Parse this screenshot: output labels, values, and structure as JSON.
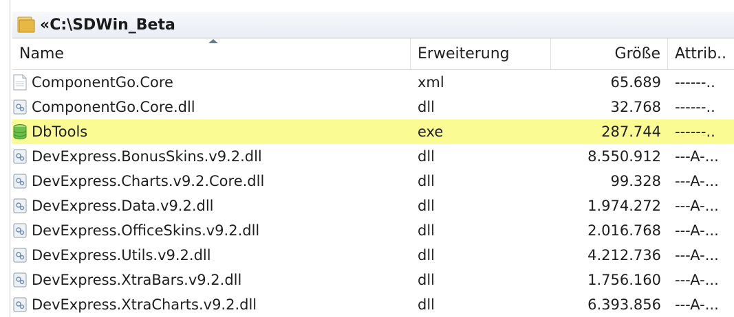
{
  "path": {
    "label": "«C:\\SDWin_Beta"
  },
  "columns": {
    "name": "Name",
    "ext": "Erweiterung",
    "size": "Größe",
    "attr": "Attrib.."
  },
  "rows": [
    {
      "name": "ComponentGo.Core",
      "ext": "xml",
      "size": "65.689",
      "attr": "------..",
      "icon": "xml-document-icon"
    },
    {
      "name": "ComponentGo.Core.dll",
      "ext": "dll",
      "size": "32.768",
      "attr": "------..",
      "icon": "dll-icon"
    },
    {
      "name": "DbTools",
      "ext": "exe",
      "size": "287.744",
      "attr": "------..",
      "icon": "database-icon",
      "highlight": true
    },
    {
      "name": "DevExpress.BonusSkins.v9.2.dll",
      "ext": "dll",
      "size": "8.550.912",
      "attr": "---A-...",
      "icon": "dll-icon"
    },
    {
      "name": "DevExpress.Charts.v9.2.Core.dll",
      "ext": "dll",
      "size": "99.328",
      "attr": "---A-...",
      "icon": "dll-icon"
    },
    {
      "name": "DevExpress.Data.v9.2.dll",
      "ext": "dll",
      "size": "1.974.272",
      "attr": "---A-...",
      "icon": "dll-icon"
    },
    {
      "name": "DevExpress.OfficeSkins.v9.2.dll",
      "ext": "dll",
      "size": "2.016.768",
      "attr": "---A-...",
      "icon": "dll-icon"
    },
    {
      "name": "DevExpress.Utils.v9.2.dll",
      "ext": "dll",
      "size": "4.212.736",
      "attr": "---A-...",
      "icon": "dll-icon"
    },
    {
      "name": "DevExpress.XtraBars.v9.2.dll",
      "ext": "dll",
      "size": "1.756.160",
      "attr": "---A-...",
      "icon": "dll-icon"
    },
    {
      "name": "DevExpress.XtraCharts.v9.2.dll",
      "ext": "dll",
      "size": "6.393.856",
      "attr": "---A-...",
      "icon": "dll-icon"
    }
  ],
  "colors": {
    "highlight": "#fbfb94",
    "pathbar": "#e9eef5",
    "folder": "#e8b845"
  }
}
